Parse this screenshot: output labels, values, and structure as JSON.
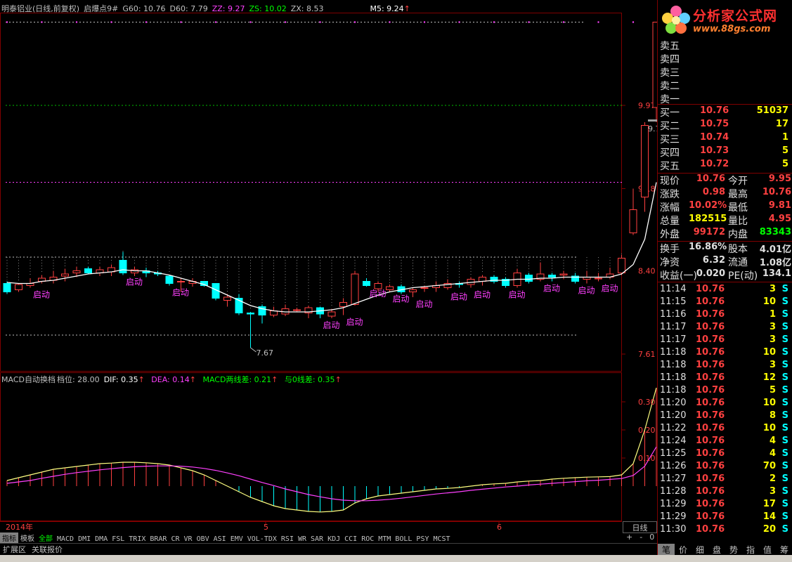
{
  "header": {
    "title": "明泰铝业(日线,前复权)",
    "indicator": "启爆点9#",
    "g60": "G60: 10.76",
    "d60": "D60: 7.79",
    "zz": "ZZ: 9.27",
    "zs": "ZS: 10.02",
    "zx": "ZX: 8.53",
    "m5": "M5: 9.24"
  },
  "price_axis": {
    "labels": [
      "9.97",
      "9.18",
      "8.40",
      "7.61"
    ]
  },
  "annotations": {
    "high_label": "10.76",
    "low_label": "7.67",
    "range_label": "9.78 - 9.81",
    "signal_text": "启动"
  },
  "macd_header": {
    "name": "MACD自动换档",
    "gear": "档位: 28.00",
    "dif": "DIF: 0.35",
    "dea": "DEA: 0.14",
    "macd": "MACD两线差: 0.21",
    "zero": "与0线差: 0.35"
  },
  "macd_axis": {
    "labels": [
      "0.30",
      "0.20",
      "0.10"
    ]
  },
  "time_axis": {
    "labels": [
      "2014年",
      "5",
      "6"
    ],
    "period_button": "日线"
  },
  "bottom_tabs": [
    "指标",
    "模板",
    "全部",
    "MACD",
    "DMI",
    "DMA",
    "FSL",
    "TRIX",
    "BRAR",
    "CR",
    "VR",
    "OBV",
    "ASI",
    "EMV",
    "VOL-TDX",
    "RSI",
    "WR",
    "SAR",
    "KDJ",
    "CCI",
    "ROC",
    "MTM",
    "BOLL",
    "PSY",
    "MCST"
  ],
  "zoom_controls": [
    "+",
    "-",
    "0"
  ],
  "status_bar": [
    "扩展区",
    "关联报价"
  ],
  "logo": {
    "title": "分析家公式网",
    "url": "www.88gs.com"
  },
  "order_book": {
    "sells": [
      {
        "label": "卖五",
        "price": "",
        "vol": ""
      },
      {
        "label": "卖四",
        "price": "",
        "vol": ""
      },
      {
        "label": "卖三",
        "price": "",
        "vol": ""
      },
      {
        "label": "卖二",
        "price": "",
        "vol": ""
      },
      {
        "label": "卖一",
        "price": "",
        "vol": ""
      }
    ],
    "buys": [
      {
        "label": "买一",
        "price": "10.76",
        "vol": "51037"
      },
      {
        "label": "买二",
        "price": "10.75",
        "vol": "17"
      },
      {
        "label": "买三",
        "price": "10.74",
        "vol": "1"
      },
      {
        "label": "买四",
        "price": "10.73",
        "vol": "5"
      },
      {
        "label": "买五",
        "price": "10.72",
        "vol": "5"
      }
    ]
  },
  "quote": [
    {
      "l1": "现价",
      "v1": "10.76",
      "c1": "#ff4040",
      "l2": "今开",
      "v2": "9.95",
      "c2": "#ff4040"
    },
    {
      "l1": "涨跌",
      "v1": "0.98",
      "c1": "#ff4040",
      "l2": "最高",
      "v2": "10.76",
      "c2": "#ff4040"
    },
    {
      "l1": "涨幅",
      "v1": "10.02%",
      "c1": "#ff4040",
      "l2": "最低",
      "v2": "9.81",
      "c2": "#ff4040"
    },
    {
      "l1": "总量",
      "v1": "182515",
      "c1": "#ffff00",
      "l2": "量比",
      "v2": "4.95",
      "c2": "#ff4040"
    },
    {
      "l1": "外盘",
      "v1": "99172",
      "c1": "#ff4040",
      "l2": "内盘",
      "v2": "83343",
      "c2": "#00ff00"
    },
    {
      "l1": "换手",
      "v1": "16.86%",
      "c1": "#e0e0e0",
      "l2": "股本",
      "v2": "4.01亿",
      "c2": "#e0e0e0"
    },
    {
      "l1": "净资",
      "v1": "6.32",
      "c1": "#e0e0e0",
      "l2": "流通",
      "v2": "1.08亿",
      "c2": "#e0e0e0"
    },
    {
      "l1": "收益(一)",
      "v1": "0.020",
      "c1": "#e0e0e0",
      "l2": "PE(动)",
      "v2": "134.1",
      "c2": "#e0e0e0"
    }
  ],
  "ticks": [
    {
      "t": "11:14",
      "p": "10.76",
      "v": "3",
      "s": "S"
    },
    {
      "t": "11:15",
      "p": "10.76",
      "v": "10",
      "s": "S"
    },
    {
      "t": "11:16",
      "p": "10.76",
      "v": "1",
      "s": "S"
    },
    {
      "t": "11:17",
      "p": "10.76",
      "v": "3",
      "s": "S"
    },
    {
      "t": "11:17",
      "p": "10.76",
      "v": "3",
      "s": "S"
    },
    {
      "t": "11:18",
      "p": "10.76",
      "v": "10",
      "s": "S"
    },
    {
      "t": "11:18",
      "p": "10.76",
      "v": "3",
      "s": "S"
    },
    {
      "t": "11:18",
      "p": "10.76",
      "v": "12",
      "s": "S"
    },
    {
      "t": "11:18",
      "p": "10.76",
      "v": "5",
      "s": "S"
    },
    {
      "t": "11:20",
      "p": "10.76",
      "v": "10",
      "s": "S"
    },
    {
      "t": "11:20",
      "p": "10.76",
      "v": "8",
      "s": "S"
    },
    {
      "t": "11:22",
      "p": "10.76",
      "v": "10",
      "s": "S"
    },
    {
      "t": "11:24",
      "p": "10.76",
      "v": "4",
      "s": "S"
    },
    {
      "t": "11:25",
      "p": "10.76",
      "v": "4",
      "s": "S"
    },
    {
      "t": "11:26",
      "p": "10.76",
      "v": "70",
      "s": "S"
    },
    {
      "t": "11:27",
      "p": "10.76",
      "v": "2",
      "s": "S"
    },
    {
      "t": "11:28",
      "p": "10.76",
      "v": "3",
      "s": "S"
    },
    {
      "t": "11:29",
      "p": "10.76",
      "v": "17",
      "s": "S"
    },
    {
      "t": "11:29",
      "p": "10.76",
      "v": "14",
      "s": "S"
    },
    {
      "t": "11:30",
      "p": "10.76",
      "v": "20",
      "s": "S"
    }
  ],
  "right_tabs": [
    "笔",
    "价",
    "细",
    "盘",
    "势",
    "指",
    "值",
    "筹"
  ],
  "chart_data": {
    "type": "candlestick",
    "y_range": [
      7.45,
      10.85
    ],
    "candles": [
      {
        "o": 8.28,
        "c": 8.2,
        "h": 8.3,
        "l": 8.18
      },
      {
        "o": 8.22,
        "c": 8.27,
        "h": 8.28,
        "l": 8.2
      },
      {
        "o": 8.26,
        "c": 8.28,
        "h": 8.33,
        "l": 8.24
      },
      {
        "o": 8.3,
        "c": 8.33,
        "h": 8.36,
        "l": 8.28
      },
      {
        "o": 8.31,
        "c": 8.34,
        "h": 8.4,
        "l": 8.28
      },
      {
        "o": 8.35,
        "c": 8.37,
        "h": 8.42,
        "l": 8.3
      },
      {
        "o": 8.38,
        "c": 8.4,
        "h": 8.44,
        "l": 8.34
      },
      {
        "o": 8.42,
        "c": 8.38,
        "h": 8.44,
        "l": 8.37
      },
      {
        "o": 8.38,
        "c": 8.41,
        "h": 8.44,
        "l": 8.35
      },
      {
        "o": 8.39,
        "c": 8.43,
        "h": 8.46,
        "l": 8.35
      },
      {
        "o": 8.5,
        "c": 8.38,
        "h": 8.58,
        "l": 8.36
      },
      {
        "o": 8.38,
        "c": 8.41,
        "h": 8.44,
        "l": 8.35
      },
      {
        "o": 8.4,
        "c": 8.38,
        "h": 8.43,
        "l": 8.34
      },
      {
        "o": 8.38,
        "c": 8.37,
        "h": 8.4,
        "l": 8.35
      },
      {
        "o": 8.35,
        "c": 8.28,
        "h": 8.36,
        "l": 8.26
      },
      {
        "o": 8.3,
        "c": 8.3,
        "h": 8.33,
        "l": 8.2
      },
      {
        "o": 8.28,
        "c": 8.3,
        "h": 8.33,
        "l": 8.25
      },
      {
        "o": 8.3,
        "c": 8.26,
        "h": 8.3,
        "l": 8.25
      },
      {
        "o": 8.28,
        "c": 8.14,
        "h": 8.28,
        "l": 8.12
      },
      {
        "o": 8.12,
        "c": 8.15,
        "h": 8.18,
        "l": 8.06
      },
      {
        "o": 8.14,
        "c": 8.0,
        "h": 8.18,
        "l": 7.98
      },
      {
        "o": 8.0,
        "c": 7.99,
        "h": 8.01,
        "l": 7.67
      },
      {
        "o": 8.06,
        "c": 7.98,
        "h": 8.08,
        "l": 7.9
      },
      {
        "o": 7.98,
        "c": 8.02,
        "h": 8.06,
        "l": 7.96
      },
      {
        "o": 7.99,
        "c": 8.04,
        "h": 8.08,
        "l": 7.97
      },
      {
        "o": 8.03,
        "c": 8.03,
        "h": 8.05,
        "l": 8.01
      },
      {
        "o": 8.0,
        "c": 8.05,
        "h": 8.07,
        "l": 7.95
      },
      {
        "o": 8.05,
        "c": 7.99,
        "h": 8.06,
        "l": 7.95
      },
      {
        "o": 7.97,
        "c": 8.01,
        "h": 8.04,
        "l": 7.95
      },
      {
        "o": 8.06,
        "c": 8.1,
        "h": 8.14,
        "l": 7.98
      },
      {
        "o": 8.08,
        "c": 8.37,
        "h": 8.4,
        "l": 8.07
      },
      {
        "o": 8.3,
        "c": 8.26,
        "h": 8.33,
        "l": 8.25
      },
      {
        "o": 8.23,
        "c": 8.28,
        "h": 8.3,
        "l": 8.2
      },
      {
        "o": 8.22,
        "c": 8.25,
        "h": 8.27,
        "l": 8.2
      },
      {
        "o": 8.25,
        "c": 8.2,
        "h": 8.27,
        "l": 8.18
      },
      {
        "o": 8.2,
        "c": 8.22,
        "h": 8.24,
        "l": 8.15
      },
      {
        "o": 8.24,
        "c": 8.24,
        "h": 8.26,
        "l": 8.2
      },
      {
        "o": 8.24,
        "c": 8.26,
        "h": 8.3,
        "l": 8.2
      },
      {
        "o": 8.24,
        "c": 8.28,
        "h": 8.32,
        "l": 8.22
      },
      {
        "o": 8.28,
        "c": 8.27,
        "h": 8.3,
        "l": 8.24
      },
      {
        "o": 8.27,
        "c": 8.32,
        "h": 8.34,
        "l": 8.24
      },
      {
        "o": 8.3,
        "c": 8.34,
        "h": 8.36,
        "l": 8.26
      },
      {
        "o": 8.34,
        "c": 8.3,
        "h": 8.36,
        "l": 8.28
      },
      {
        "o": 8.32,
        "c": 8.26,
        "h": 8.34,
        "l": 8.24
      },
      {
        "o": 8.26,
        "c": 8.38,
        "h": 8.42,
        "l": 8.24
      },
      {
        "o": 8.36,
        "c": 8.3,
        "h": 8.38,
        "l": 8.28
      },
      {
        "o": 8.32,
        "c": 8.37,
        "h": 8.48,
        "l": 8.3
      },
      {
        "o": 8.36,
        "c": 8.34,
        "h": 8.38,
        "l": 8.3
      },
      {
        "o": 8.36,
        "c": 8.37,
        "h": 8.4,
        "l": 8.32
      },
      {
        "o": 8.35,
        "c": 8.3,
        "h": 8.38,
        "l": 8.28
      },
      {
        "o": 8.32,
        "c": 8.34,
        "h": 8.4,
        "l": 8.28
      },
      {
        "o": 8.33,
        "c": 8.33,
        "h": 8.38,
        "l": 8.3
      },
      {
        "o": 8.34,
        "c": 8.37,
        "h": 8.43,
        "l": 8.32
      },
      {
        "o": 8.38,
        "c": 8.52,
        "h": 8.55,
        "l": 8.36
      },
      {
        "o": 8.76,
        "c": 8.98,
        "h": 9.18,
        "l": 8.74
      },
      {
        "o": 9.1,
        "c": 9.78,
        "h": 9.81,
        "l": 8.96
      },
      {
        "o": 9.95,
        "c": 10.76,
        "h": 10.76,
        "l": 9.81
      }
    ],
    "ma_line": [
      8.29,
      8.28,
      8.28,
      8.3,
      8.31,
      8.33,
      8.35,
      8.37,
      8.38,
      8.39,
      8.41,
      8.4,
      8.4,
      8.38,
      8.36,
      8.33,
      8.3,
      8.27,
      8.22,
      8.17,
      8.12,
      8.07,
      8.04,
      8.02,
      8.01,
      8.01,
      8.01,
      8.02,
      8.03,
      8.05,
      8.09,
      8.13,
      8.17,
      8.2,
      8.22,
      8.24,
      8.25,
      8.26,
      8.27,
      8.28,
      8.29,
      8.3,
      8.31,
      8.31,
      8.32,
      8.32,
      8.33,
      8.33,
      8.34,
      8.34,
      8.34,
      8.34,
      8.34,
      8.37,
      8.46,
      8.7,
      9.24
    ],
    "signals": [
      2,
      10,
      14,
      27,
      29,
      31,
      33,
      35,
      38,
      40,
      43,
      46,
      49,
      51
    ],
    "macd": {
      "y_range": [
        -0.12,
        0.38
      ],
      "dif": [
        0.02,
        0.03,
        0.04,
        0.05,
        0.06,
        0.065,
        0.07,
        0.075,
        0.08,
        0.082,
        0.085,
        0.085,
        0.083,
        0.08,
        0.075,
        0.065,
        0.055,
        0.04,
        0.02,
        0.0,
        -0.02,
        -0.04,
        -0.055,
        -0.07,
        -0.08,
        -0.085,
        -0.09,
        -0.092,
        -0.09,
        -0.085,
        -0.06,
        -0.045,
        -0.035,
        -0.03,
        -0.025,
        -0.02,
        -0.015,
        -0.01,
        -0.008,
        -0.005,
        0.0,
        0.005,
        0.008,
        0.01,
        0.015,
        0.018,
        0.02,
        0.025,
        0.028,
        0.03,
        0.032,
        0.033,
        0.034,
        0.04,
        0.08,
        0.2,
        0.35
      ],
      "dea": [
        0.01,
        0.015,
        0.02,
        0.028,
        0.035,
        0.042,
        0.048,
        0.053,
        0.058,
        0.062,
        0.066,
        0.069,
        0.071,
        0.072,
        0.072,
        0.071,
        0.068,
        0.063,
        0.056,
        0.047,
        0.037,
        0.025,
        0.013,
        0.002,
        -0.01,
        -0.02,
        -0.03,
        -0.038,
        -0.045,
        -0.05,
        -0.052,
        -0.052,
        -0.05,
        -0.047,
        -0.043,
        -0.038,
        -0.033,
        -0.028,
        -0.024,
        -0.02,
        -0.015,
        -0.011,
        -0.007,
        -0.003,
        0.0,
        0.004,
        0.007,
        0.01,
        0.013,
        0.016,
        0.019,
        0.021,
        0.024,
        0.027,
        0.038,
        0.071,
        0.14
      ]
    }
  }
}
